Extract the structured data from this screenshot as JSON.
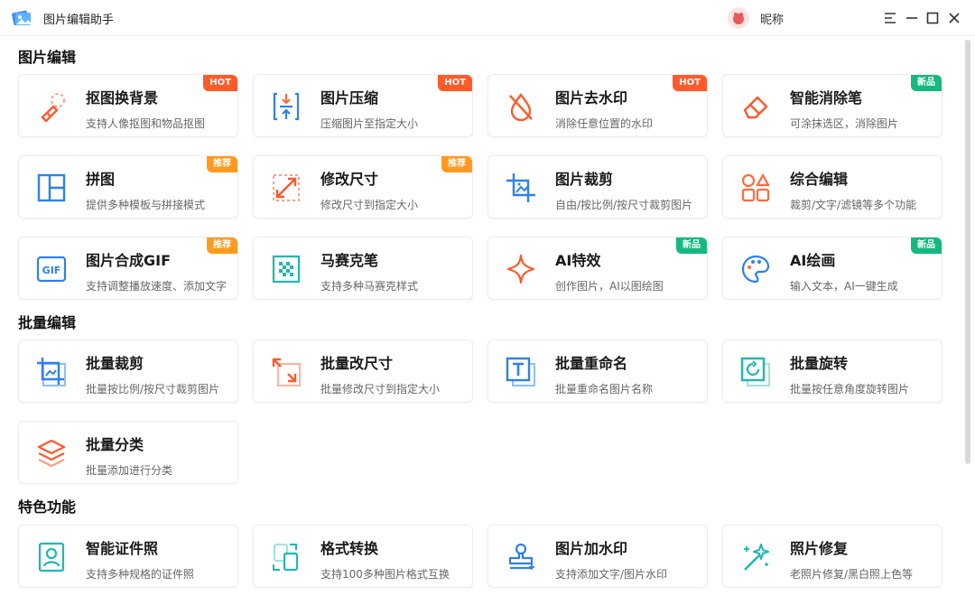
{
  "app": {
    "title": "图片编辑助手",
    "user_name": "昵称"
  },
  "colors": {
    "hot": "#ff5a2a",
    "recommend": "#ff9a1f",
    "new": "#16b97d",
    "blue": "#2f80ed",
    "orange": "#ff6a3d",
    "teal": "#1fb8b0"
  },
  "sections": [
    {
      "title": "图片编辑"
    },
    {
      "title": "批量编辑"
    },
    {
      "title": "特色功能"
    }
  ],
  "cards": [
    {
      "title": "抠图换背景",
      "desc": "支持人像抠图和物品抠图",
      "badge": "HOT",
      "icon": "eraser-icon"
    },
    {
      "title": "图片压缩",
      "desc": "压缩图片至指定大小",
      "badge": "HOT",
      "icon": "compress-icon"
    },
    {
      "title": "图片去水印",
      "desc": "消除任意位置的水印",
      "badge": "HOT",
      "icon": "no-watermark-icon"
    },
    {
      "title": "智能消除笔",
      "desc": "可涂抹选区，消除图片",
      "badge": "新品",
      "icon": "smart-eraser-icon"
    },
    {
      "title": "拼图",
      "desc": "提供多种模板与拼接模式",
      "badge": "推荐",
      "icon": "collage-icon"
    },
    {
      "title": "修改尺寸",
      "desc": "修改尺寸到指定大小",
      "badge": "推荐",
      "icon": "resize-icon"
    },
    {
      "title": "图片裁剪",
      "desc": "自由/按比例/按尺寸裁剪图片",
      "badge": "",
      "icon": "crop-icon"
    },
    {
      "title": "综合编辑",
      "desc": "裁剪/文字/滤镜等多个功能",
      "badge": "",
      "icon": "shapes-icon"
    },
    {
      "title": "图片合成GIF",
      "desc": "支持调整播放速度、添加文字",
      "badge": "推荐",
      "icon": "gif-icon"
    },
    {
      "title": "马赛克笔",
      "desc": "支持多种马赛克样式",
      "badge": "",
      "icon": "mosaic-icon"
    },
    {
      "title": "AI特效",
      "desc": "创作图片，AI以图绘图",
      "badge": "新品",
      "icon": "sparkle-icon"
    },
    {
      "title": "AI绘画",
      "desc": "输入文本，AI一键生成",
      "badge": "新品",
      "icon": "palette-icon"
    },
    {
      "title": "批量裁剪",
      "desc": "批量按比例/按尺寸裁剪图片",
      "badge": "",
      "icon": "batch-crop-icon"
    },
    {
      "title": "批量改尺寸",
      "desc": "批量修改尺寸到指定大小",
      "badge": "",
      "icon": "batch-resize-icon"
    },
    {
      "title": "批量重命名",
      "desc": "批量重命名图片名称",
      "badge": "",
      "icon": "rename-icon"
    },
    {
      "title": "批量旋转",
      "desc": "批量按任意角度旋转图片",
      "badge": "",
      "icon": "rotate-icon"
    },
    {
      "title": "批量分类",
      "desc": "批量添加进行分类",
      "badge": "",
      "icon": "layers-icon"
    },
    {
      "title": "智能证件照",
      "desc": "支持多种规格的证件照",
      "badge": "",
      "icon": "id-photo-icon"
    },
    {
      "title": "格式转换",
      "desc": "支持100多种图片格式互换",
      "badge": "",
      "icon": "convert-icon"
    },
    {
      "title": "图片加水印",
      "desc": "支持添加文字/图片水印",
      "badge": "",
      "icon": "stamp-icon"
    },
    {
      "title": "照片修复",
      "desc": "老照片修复/黑白照上色等",
      "badge": "",
      "icon": "magic-wand-icon"
    }
  ]
}
